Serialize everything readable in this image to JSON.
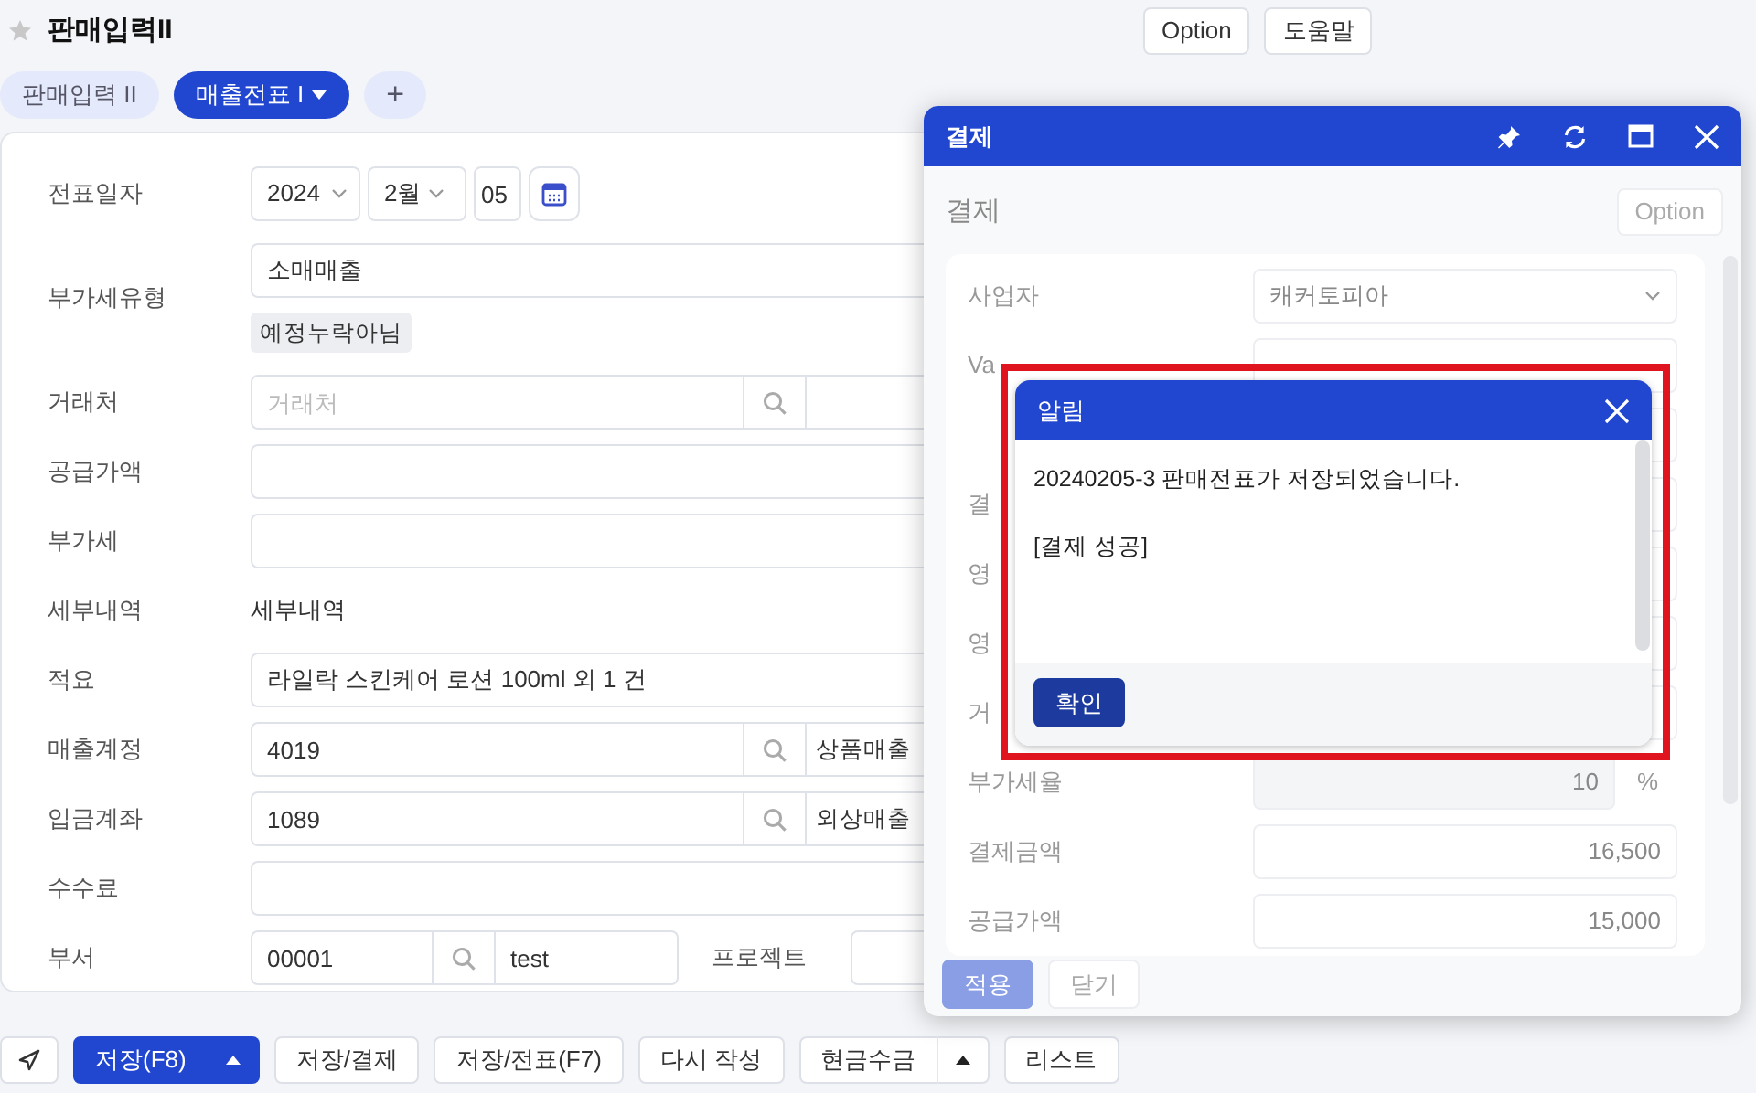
{
  "page": {
    "title": "판매입력II",
    "favorite": false,
    "buttons": [
      "Option",
      "도움말"
    ]
  },
  "tabs": [
    {
      "label": "판매입력 II",
      "selected": false,
      "has_menu": false
    },
    {
      "label": "매출전표 I",
      "selected": true,
      "has_menu": true
    }
  ],
  "add_tab": "+",
  "form": {
    "rows": [
      {
        "kind": "date",
        "label": "전표일자",
        "year": "2024",
        "month": "2월",
        "day": "05"
      },
      {
        "kind": "vat",
        "label": "부가세유형",
        "value": "소매매출",
        "tag": "예정누락아님"
      },
      {
        "kind": "lookup",
        "label": "거래처",
        "placeholder": "거래처"
      },
      {
        "kind": "text",
        "label": "공급가액"
      },
      {
        "kind": "text",
        "label": "부가세"
      },
      {
        "kind": "plain",
        "label": "세부내역",
        "value": "세부내역"
      },
      {
        "kind": "text",
        "label": "적요",
        "value": "라일락 스킨케어 로션 100ml 외 1 건"
      },
      {
        "kind": "lookup",
        "label": "매출계정",
        "value": "4019",
        "name": "상품매출"
      },
      {
        "kind": "lookup",
        "label": "입금계좌",
        "value": "1089",
        "name": "외상매출"
      },
      {
        "kind": "text",
        "label": "수수료"
      },
      {
        "kind": "dept",
        "label": "부서",
        "value": "00001",
        "name": "test",
        "extra_label": "프로젝트"
      }
    ]
  },
  "toolbar": [
    {
      "kind": "icon"
    },
    {
      "kind": "button",
      "label": "저장(F8)",
      "primary": true,
      "split": true
    },
    {
      "kind": "button",
      "label": "저장/결제",
      "primary": false,
      "split": false
    },
    {
      "kind": "button",
      "label": "저장/전표(F7)",
      "primary": false,
      "split": false
    },
    {
      "kind": "button",
      "label": "다시 작성",
      "primary": false,
      "split": false
    },
    {
      "kind": "button",
      "label": "현금수금",
      "primary": false,
      "split": true
    },
    {
      "kind": "button",
      "label": "리스트",
      "primary": false,
      "split": false
    }
  ],
  "modal": {
    "title": "결제",
    "heading": "결제",
    "option": "Option",
    "rows": [
      {
        "kind": "select",
        "label": "사업자",
        "value": "캐커토피아"
      },
      {
        "kind": "text",
        "label": "Va"
      },
      {
        "kind": "text"
      },
      {
        "kind": "text",
        "label": "결"
      },
      {
        "kind": "text",
        "label": "영"
      },
      {
        "kind": "text",
        "label": "영"
      },
      {
        "kind": "text",
        "label": "거"
      },
      {
        "kind": "readonly",
        "label": "부가세율",
        "value": "10",
        "unit": "%"
      },
      {
        "kind": "text",
        "label": "결제금액",
        "value": "16,500"
      },
      {
        "kind": "text",
        "label": "공급가액",
        "value": "15,000"
      }
    ],
    "buttons": [
      {
        "label": "적용",
        "primary": true
      },
      {
        "label": "닫기",
        "primary": false
      }
    ]
  },
  "alert": {
    "title": "알림",
    "lines": [
      "20240205-3 판매전표가 저장되었습니다.",
      "[결제 성공]"
    ],
    "button": "확인",
    "highlighted": true
  }
}
